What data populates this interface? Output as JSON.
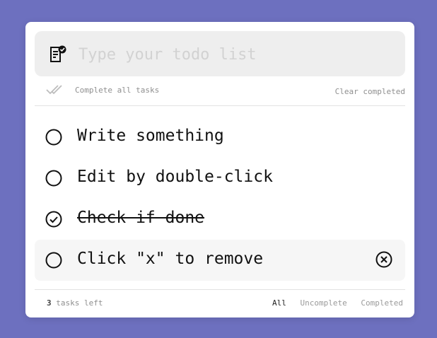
{
  "input": {
    "placeholder": "Type your todo list",
    "value": ""
  },
  "toolbar": {
    "complete_all_label": "Complete all tasks",
    "clear_completed_label": "Clear completed"
  },
  "todos": [
    {
      "label": "Write something",
      "done": false
    },
    {
      "label": "Edit by double-click",
      "done": false
    },
    {
      "label": "Check if done",
      "done": true
    },
    {
      "label": "Click \"x\" to remove",
      "done": false
    }
  ],
  "footer": {
    "count": "3",
    "count_suffix": "tasks left",
    "filters": [
      {
        "label": "All",
        "active": true
      },
      {
        "label": "Uncomplete",
        "active": false
      },
      {
        "label": "Completed",
        "active": false
      }
    ]
  },
  "colors": {
    "background": "#6d70bf",
    "card": "#ffffff",
    "input_bg": "#eeeeee",
    "muted": "#8f8f8f"
  },
  "icons": [
    "todo-list-icon",
    "double-check-icon",
    "circle-icon",
    "circle-check-icon",
    "circle-x-icon"
  ]
}
